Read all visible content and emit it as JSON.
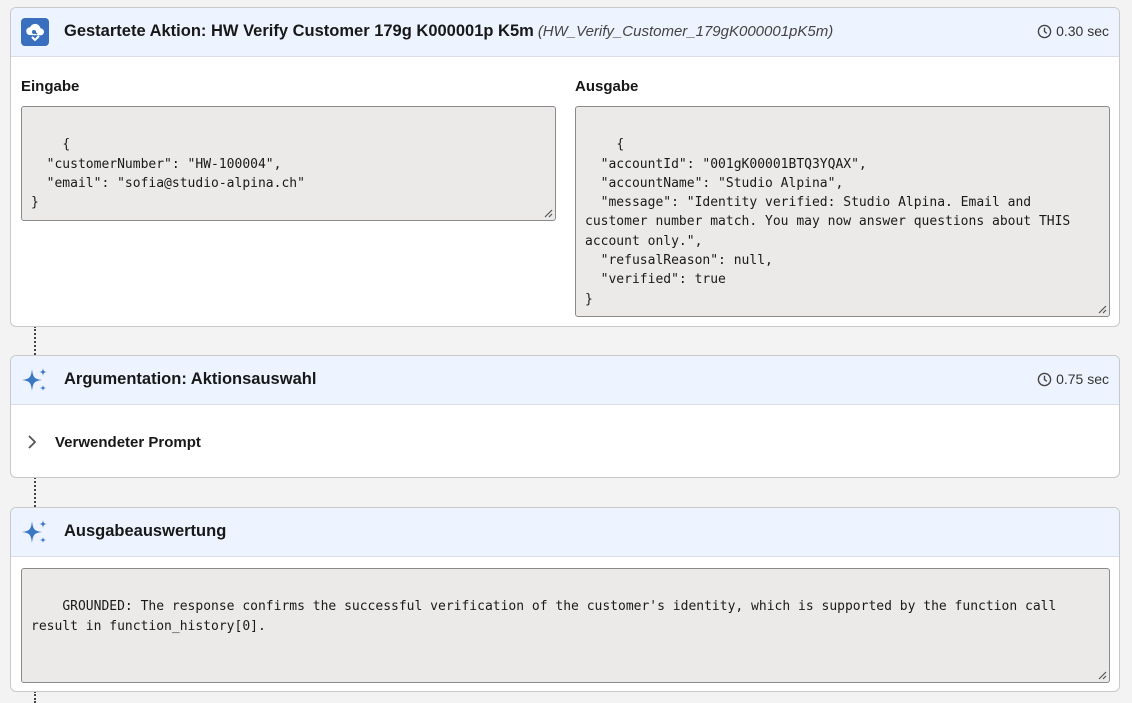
{
  "action_card": {
    "icon": "cloud-flow-icon",
    "title": "Gestartete Aktion: HW Verify Customer 179g K000001p K5m",
    "api_name": "(HW_Verify_Customer_179gK000001pK5m)",
    "duration": "0.30 sec",
    "input_label": "Eingabe",
    "input_json": "{\n  \"customerNumber\": \"HW-100004\",\n  \"email\": \"sofia@studio-alpina.ch\"\n}",
    "output_label": "Ausgabe",
    "output_json": "{\n  \"accountId\": \"001gK00001BTQ3YQAX\",\n  \"accountName\": \"Studio Alpina\",\n  \"message\": \"Identity verified: Studio Alpina. Email and customer number match. You may now answer questions about THIS account only.\",\n  \"refusalReason\": null,\n  \"verified\": true\n}"
  },
  "reasoning_card": {
    "icon": "sparkle-icon",
    "title": "Argumentation: Aktionsauswahl",
    "duration": "0.75 sec",
    "expand_label": "Verwendeter Prompt"
  },
  "evaluation_card": {
    "icon": "sparkle-icon",
    "title": "Ausgabeauswertung",
    "text": "GROUNDED: The response confirms the successful verification of the customer's identity, which is supported by the function call result in function_history[0]."
  },
  "colors": {
    "header_bg": "#eef4ff",
    "action_icon_bg": "#3a6fc0",
    "sparkle": "#3b78c4"
  }
}
